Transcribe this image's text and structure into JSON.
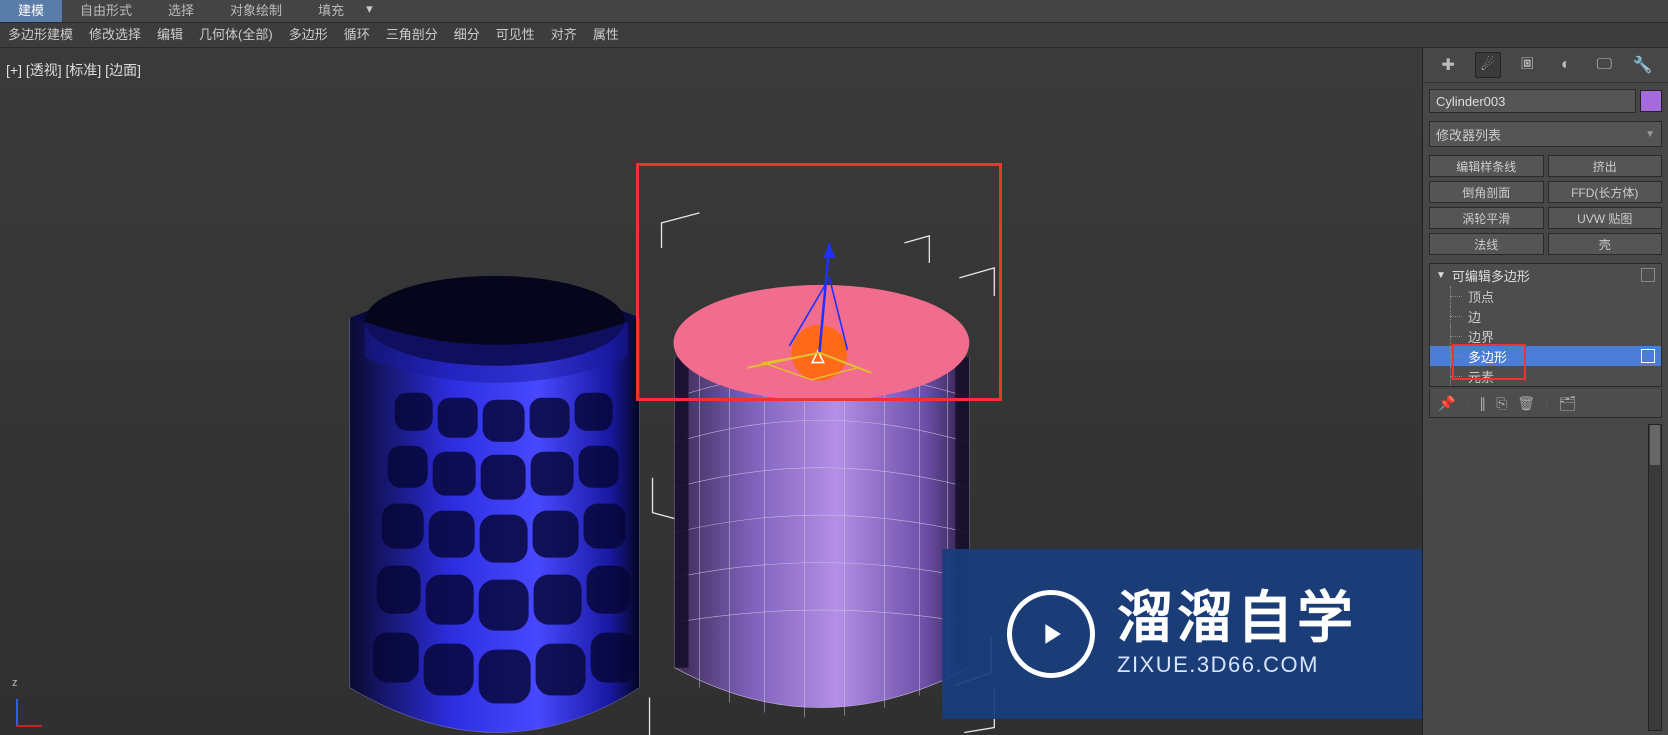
{
  "topbar1": {
    "tabs": [
      "建模",
      "自由形式",
      "选择",
      "对象绘制",
      "填充"
    ],
    "active_index": 0
  },
  "topbar2": {
    "items": [
      "多边形建模",
      "修改选择",
      "编辑",
      "几何体(全部)",
      "多边形",
      "循环",
      "三角剖分",
      "细分",
      "可见性",
      "对齐",
      "属性"
    ]
  },
  "viewport": {
    "label": "[+] [透视] [标准] [边面]",
    "axis_z_label": "z"
  },
  "rpanel": {
    "object_name": "Cylinder003",
    "swatch_color": "#a66bdc",
    "modifier_dropdown": "修改器列表",
    "quick_buttons": [
      "编辑样条线",
      "挤出",
      "倒角剖面",
      "FFD(长方体)",
      "涡轮平滑",
      "UVW 贴图",
      "法线",
      "壳"
    ],
    "modifier_header": "可编辑多边形",
    "sub_levels": [
      "顶点",
      "边",
      "边界",
      "多边形",
      "元素"
    ],
    "selected_sub_index": 3
  },
  "watermark": {
    "title_cn": "溜溜自学",
    "title_en": "ZIXUE.3D66.COM"
  }
}
